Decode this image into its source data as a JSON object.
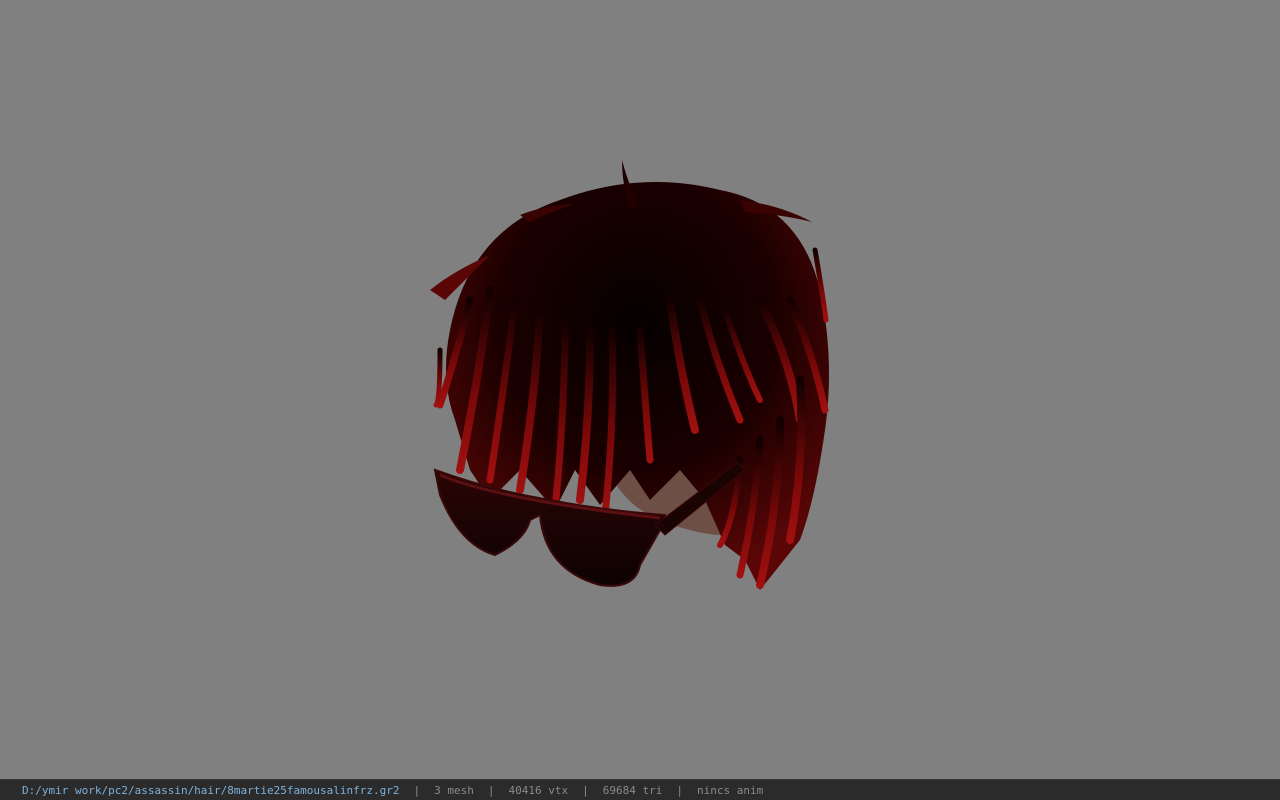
{
  "viewer": {
    "background_color": "#808080",
    "model": {
      "icon": "hair-model-with-sunglasses",
      "hair_color": "#8b0a0a",
      "hair_shadow_color": "#0a0000"
    }
  },
  "statusbar": {
    "file_path": "D:/ymir work/pc2/assassin/hair/8martie25famousalinfrz.gr2",
    "separator": "|",
    "mesh": "3 mesh",
    "vtx": "40416 vtx",
    "tri": "69684 tri",
    "anim": "nincs anim",
    "path_color": "#7fb0d8",
    "text_color": "#8a8a8a"
  }
}
